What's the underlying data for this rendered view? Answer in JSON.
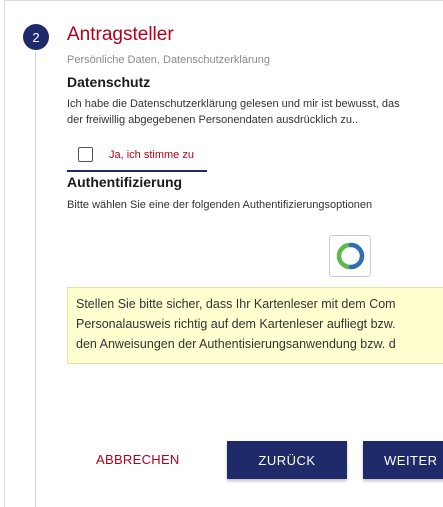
{
  "step": {
    "number": "2",
    "title": "Antragsteller",
    "subtitle": "Persönliche Daten, Datenschutzerklärung"
  },
  "privacy": {
    "heading": "Datenschutz",
    "text_line1": "Ich habe die Datenschutzerklärung gelesen und mir ist bewusst, das",
    "text_line2": "der freiwillig abgegebenen Personendaten ausdrücklich zu..",
    "consent_label": "Ja, ich stimme zu",
    "consent_checked": false
  },
  "auth": {
    "heading": "Authentifizierung",
    "instruction": "Bitte wählen Sie eine der folgenden Authentifizierungsoptionen",
    "option_icon": "ausweisapp-icon",
    "icon_colors": {
      "green": "#5fb84a",
      "blue": "#2e6fb6"
    }
  },
  "info": {
    "line1": "Stellen Sie bitte sicher, dass Ihr Kartenleser mit dem Com",
    "line2": "Personalausweis richtig auf dem Kartenleser aufliegt bzw.",
    "line3": "den Anweisungen der Authentisierungsanwendung bzw. d"
  },
  "actions": {
    "cancel": "ABBRECHEN",
    "back": "ZURÜCK",
    "next": "WEITER"
  },
  "colors": {
    "accent_red": "#b3001b",
    "primary_navy": "#1f2a6b",
    "info_bg": "#ffffcf"
  }
}
